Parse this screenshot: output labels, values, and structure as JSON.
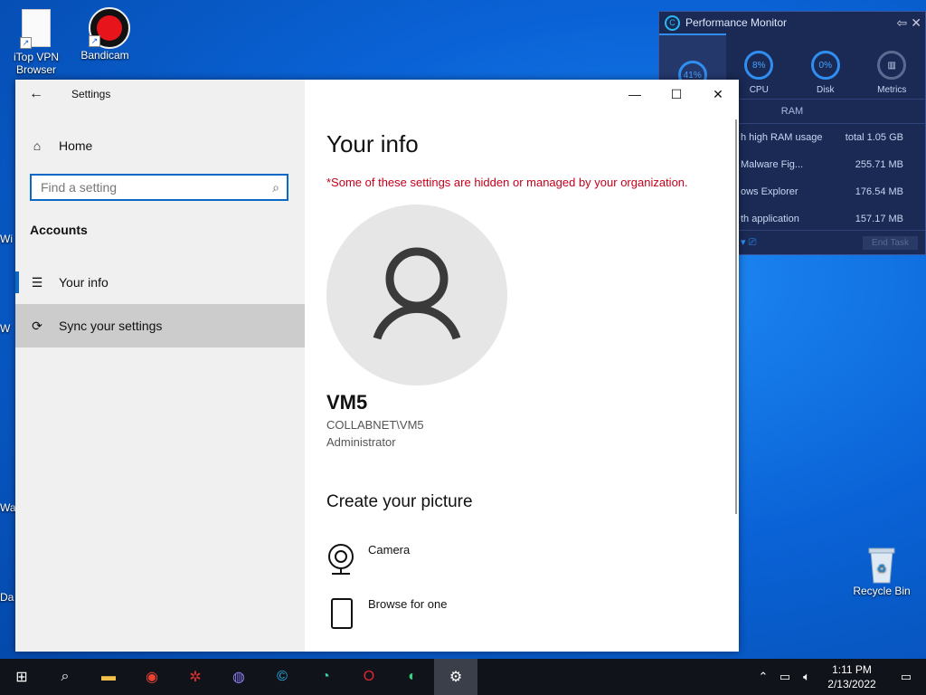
{
  "desktop": {
    "icons": [
      {
        "label": "iTop VPN Browser"
      },
      {
        "label": "Bandicam"
      },
      {
        "label": "Recycle Bin"
      }
    ],
    "edge_fragments": [
      "Wi",
      "W",
      "Wa",
      "Da"
    ]
  },
  "perf_monitor": {
    "title": "Performance Monitor",
    "tabs": [
      {
        "value": "41%",
        "label": ""
      },
      {
        "value": "8%",
        "label": "CPU"
      },
      {
        "value": "0%",
        "label": "Disk"
      },
      {
        "value": "",
        "label": "Metrics"
      }
    ],
    "sub_header": "RAM",
    "rows": [
      {
        "name": "h high RAM usage",
        "value": "total 1.05 GB"
      },
      {
        "name": "Malware Fig...",
        "value": "255.71 MB"
      },
      {
        "name": "ows Explorer",
        "value": "176.54 MB"
      },
      {
        "name": "th application",
        "value": "157.17 MB"
      }
    ],
    "end_task": "End Task"
  },
  "settings": {
    "window_title": "Settings",
    "home": "Home",
    "search_placeholder": "Find a setting",
    "section": "Accounts",
    "nav": [
      {
        "label": "Your info",
        "icon": "person-card-icon"
      },
      {
        "label": "Sync your settings",
        "icon": "sync-icon"
      }
    ],
    "page_title": "Your info",
    "warning": "*Some of these settings are hidden or managed by your organization.",
    "user_name": "VM5",
    "account": "COLLABNET\\VM5",
    "role": "Administrator",
    "create_title": "Create your picture",
    "options": [
      {
        "label": "Camera",
        "icon": "camera-icon"
      },
      {
        "label": "Browse for one",
        "icon": "file-icon"
      }
    ]
  },
  "taskbar": {
    "time": "1:11 PM",
    "date": "2/13/2022"
  }
}
